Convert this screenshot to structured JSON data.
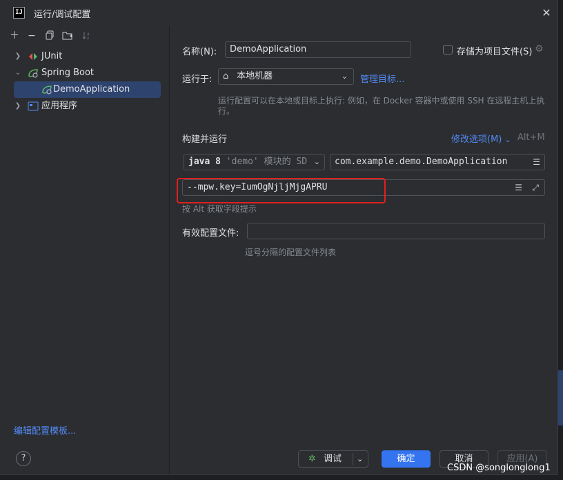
{
  "window": {
    "title": "运行/调试配置",
    "app_icon_text": "IJ"
  },
  "left_pane": {
    "tree": [
      {
        "label": "JUnit"
      },
      {
        "label": "Spring Boot"
      },
      {
        "label": "DemoApplication"
      },
      {
        "label": "应用程序"
      }
    ],
    "edit_templates_link": "编辑配置模板..."
  },
  "form": {
    "name_label": "名称(N):",
    "name_value": "DemoApplication",
    "store_as_project_file_label": "存储为项目文件(S)",
    "run_on_label": "运行于:",
    "run_on_value": "本地机器",
    "manage_targets_link": "管理目标...",
    "run_on_hint_line1": "运行配置可以在本地或目标上执行: 例如，在 Docker 容器中或使用 SSH 在远程主机上执",
    "run_on_hint_line2": "行。",
    "build_and_run_label": "构建并运行",
    "modify_options_link": "修改选项(M)",
    "modify_options_shortcut": "Alt+M",
    "jdk_value": "java 8",
    "jdk_module_hint": "'demo' 模块的 SD",
    "main_class_value": "com.example.demo.DemoApplication",
    "program_args_value": "--mpw.key=IumOgNjljMjgAPRU",
    "program_args_hint": "按 Alt 获取字段提示",
    "active_profiles_label": "有效配置文件:",
    "active_profiles_value": "",
    "active_profiles_hint": "逗号分隔的配置文件列表"
  },
  "footer": {
    "help_label": "?",
    "debug_label": "调试",
    "ok_label": "确定",
    "cancel_label": "取消",
    "apply_label": "应用(A)"
  },
  "watermark": "CSDN @songlonglong1",
  "colors": {
    "dialog_bg": "#2b2d30",
    "selection": "#2e436e",
    "link": "#548af7",
    "primary_button": "#3574f0",
    "highlight_box": "#e02020"
  }
}
